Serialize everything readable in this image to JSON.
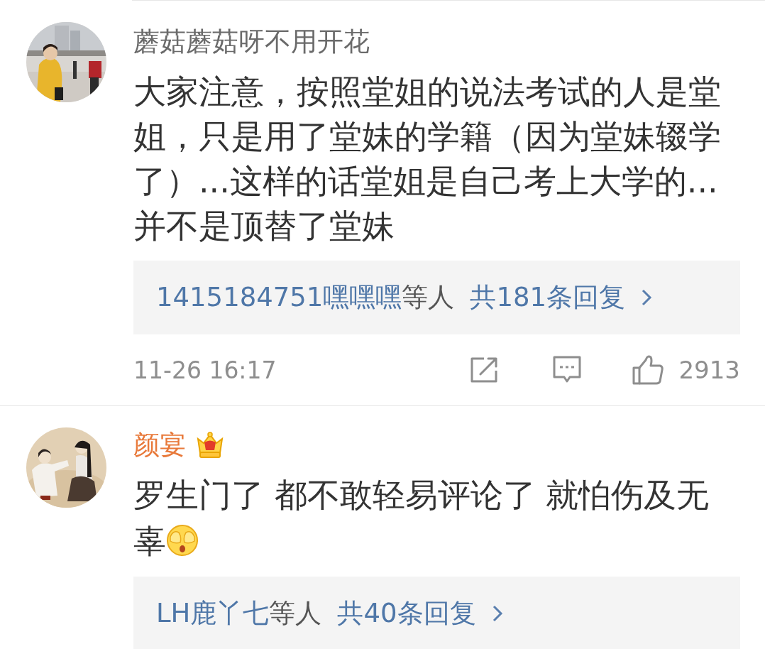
{
  "comments": [
    {
      "author": "蘑菇蘑菇呀不用开花",
      "vip": false,
      "text": "大家注意，按照堂姐的说法考试的人是堂姐，只是用了堂妹的学籍（因为堂妹辍学了）...这样的话堂姐是自己考上大学的...并不是顶替了堂妹",
      "ends_with_emoji": false,
      "replies": {
        "users": "1415184751嘿嘿嘿",
        "suffix": "等人",
        "count": "共181条回复"
      },
      "footer": {
        "time": "11-26 16:17",
        "likes": "2913"
      }
    },
    {
      "author": "颜宴",
      "vip": true,
      "text": "罗生门了 都不敢轻易评论了 就怕伤及无辜",
      "ends_with_emoji": true,
      "replies": {
        "users": "LH鹿丫七",
        "suffix": "等人",
        "count": "共40条回复"
      }
    }
  ]
}
